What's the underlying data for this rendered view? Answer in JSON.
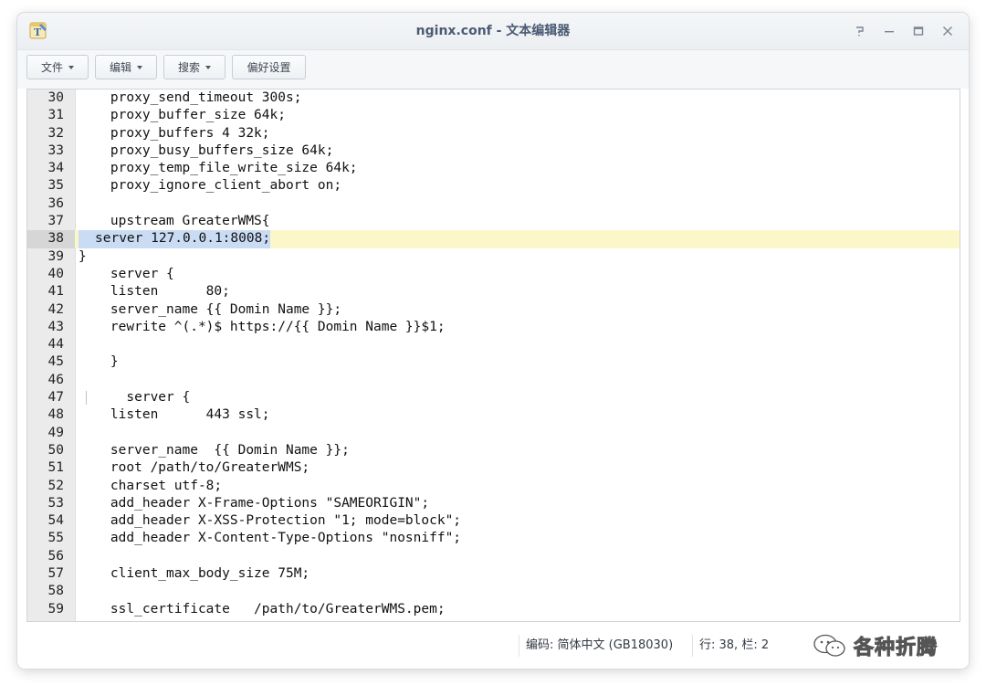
{
  "window": {
    "title": "nginx.conf - 文本编辑器"
  },
  "toolbar": {
    "file_label": "文件",
    "edit_label": "编辑",
    "search_label": "搜索",
    "prefs_label": "偏好设置"
  },
  "editor": {
    "current_line": 38,
    "lines": [
      {
        "n": "30",
        "t": "    proxy_send_timeout 300s;"
      },
      {
        "n": "31",
        "t": "    proxy_buffer_size 64k;"
      },
      {
        "n": "32",
        "t": "    proxy_buffers 4 32k;"
      },
      {
        "n": "33",
        "t": "    proxy_busy_buffers_size 64k;"
      },
      {
        "n": "34",
        "t": "    proxy_temp_file_write_size 64k;"
      },
      {
        "n": "35",
        "t": "    proxy_ignore_client_abort on;"
      },
      {
        "n": "36",
        "t": ""
      },
      {
        "n": "37",
        "t": "    upstream GreaterWMS{"
      },
      {
        "n": "38",
        "t": "server 127.0.0.1:8008;"
      },
      {
        "n": "39",
        "t": "}"
      },
      {
        "n": "40",
        "t": "    server {"
      },
      {
        "n": "41",
        "t": "    listen      80;"
      },
      {
        "n": "42",
        "t": "    server_name {{ Domin Name }};"
      },
      {
        "n": "43",
        "t": "    rewrite ^(.*)$ https://{{ Domin Name }}$1;"
      },
      {
        "n": "44",
        "t": ""
      },
      {
        "n": "45",
        "t": "    }"
      },
      {
        "n": "46",
        "t": ""
      },
      {
        "n": "47",
        "t": "      server {"
      },
      {
        "n": "48",
        "t": "    listen      443 ssl;"
      },
      {
        "n": "49",
        "t": ""
      },
      {
        "n": "50",
        "t": "    server_name  {{ Domin Name }};"
      },
      {
        "n": "51",
        "t": "    root /path/to/GreaterWMS;"
      },
      {
        "n": "52",
        "t": "    charset utf-8;"
      },
      {
        "n": "53",
        "t": "    add_header X-Frame-Options \"SAMEORIGIN\";"
      },
      {
        "n": "54",
        "t": "    add_header X-XSS-Protection \"1; mode=block\";"
      },
      {
        "n": "55",
        "t": "    add_header X-Content-Type-Options \"nosniff\";"
      },
      {
        "n": "56",
        "t": ""
      },
      {
        "n": "57",
        "t": "    client_max_body_size 75M;"
      },
      {
        "n": "58",
        "t": ""
      },
      {
        "n": "59",
        "t": "    ssl_certificate   /path/to/GreaterWMS.pem;"
      }
    ]
  },
  "status": {
    "encoding": "编码: 简体中文 (GB18030)",
    "position": "行: 38, 栏: 2"
  },
  "watermark": {
    "text": "各种折腾"
  }
}
